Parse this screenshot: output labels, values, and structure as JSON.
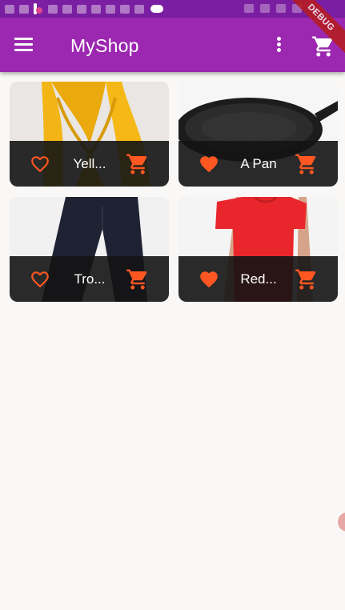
{
  "app_bar": {
    "title": "MyShop"
  },
  "debug_banner": "DEBUG",
  "colors": {
    "status_bar": "#7b1fa2",
    "app_bar": "#9c27b0",
    "accent": "#ff5722",
    "card_footer": "#141414"
  },
  "products": [
    {
      "title": "Yell...",
      "favorite": false,
      "image": "yellow-scarf"
    },
    {
      "title": "A Pan",
      "favorite": true,
      "image": "pan"
    },
    {
      "title": "Tro...",
      "favorite": false,
      "image": "trousers"
    },
    {
      "title": "Red...",
      "favorite": true,
      "image": "red-shirt"
    }
  ],
  "icons": {
    "menu": "menu-icon",
    "more": "more-vert-icon",
    "cart": "shopping-cart-icon",
    "favorite": "heart-icon"
  }
}
